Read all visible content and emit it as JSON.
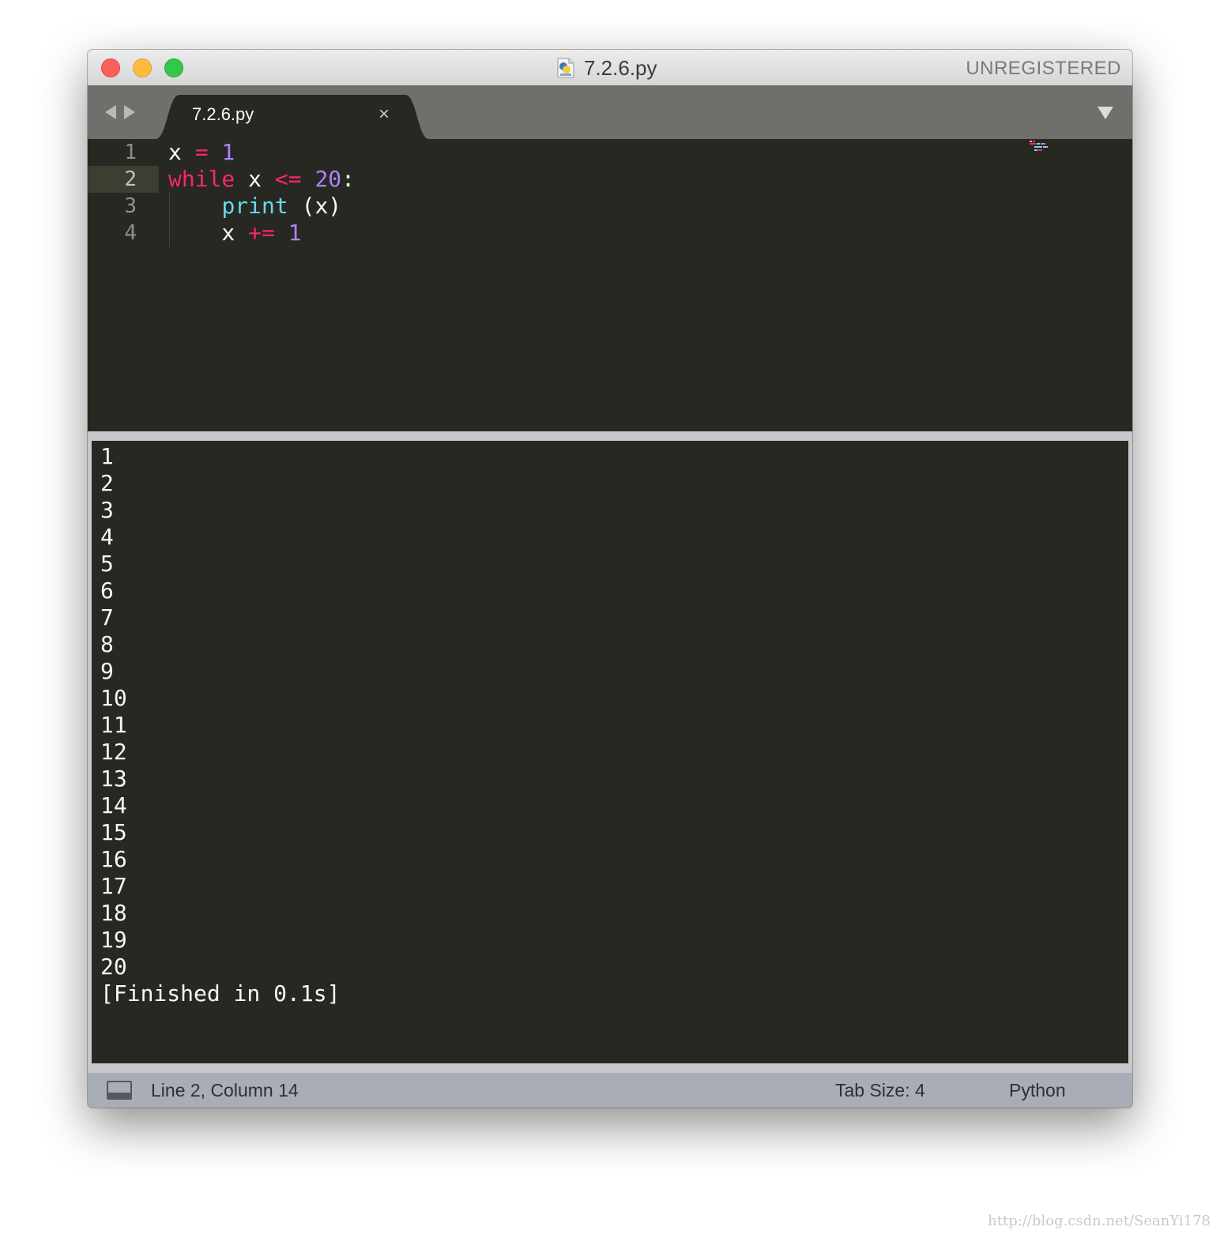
{
  "window": {
    "title": "7.2.6.py",
    "registration": "UNREGISTERED"
  },
  "tabs": [
    {
      "label": "7.2.6.py",
      "close_symbol": "×",
      "active": true
    }
  ],
  "editor": {
    "lines": [
      {
        "number": "1",
        "tokens": [
          [
            "x ",
            "plain"
          ],
          [
            "=",
            "op"
          ],
          [
            " ",
            "plain"
          ],
          [
            "1",
            "num"
          ]
        ]
      },
      {
        "number": "2",
        "active": true,
        "tokens": [
          [
            "while",
            "kw"
          ],
          [
            " x ",
            "plain"
          ],
          [
            "<=",
            "op"
          ],
          [
            " ",
            "plain"
          ],
          [
            "20",
            "num"
          ],
          [
            ":",
            "plain"
          ]
        ]
      },
      {
        "number": "3",
        "tokens": [
          [
            "    ",
            "plain"
          ],
          [
            "print",
            "fn"
          ],
          [
            " (x)",
            "plain"
          ]
        ]
      },
      {
        "number": "4",
        "tokens": [
          [
            "    x ",
            "plain"
          ],
          [
            "+=",
            "op"
          ],
          [
            " ",
            "plain"
          ],
          [
            "1",
            "num"
          ]
        ]
      }
    ]
  },
  "output": {
    "lines": [
      "1",
      "2",
      "3",
      "4",
      "5",
      "6",
      "7",
      "8",
      "9",
      "10",
      "11",
      "12",
      "13",
      "14",
      "15",
      "16",
      "17",
      "18",
      "19",
      "20",
      "[Finished in 0.1s]"
    ]
  },
  "status": {
    "position": "Line 2, Column 14",
    "tab_size": "Tab Size: 4",
    "syntax": "Python"
  },
  "watermark": "http://blog.csdn.net/SeanYi178",
  "colors": {
    "editor_bg": "#272822",
    "keyword": "#f92672",
    "number": "#ae81ff",
    "function": "#66d9ef",
    "text": "#f8f8f2"
  }
}
